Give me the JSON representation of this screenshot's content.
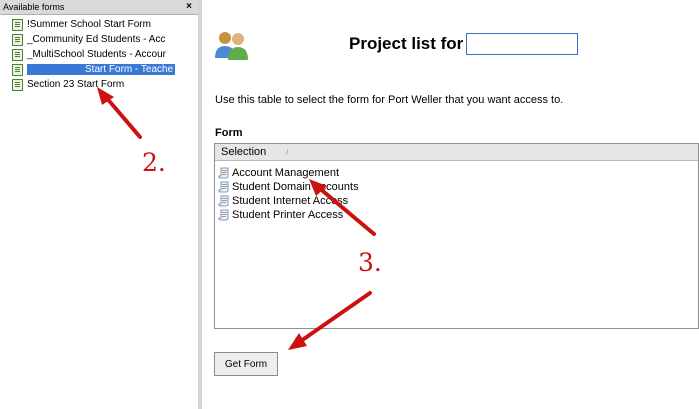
{
  "left_panel": {
    "title": "Available forms",
    "close_glyph": "×",
    "items": [
      {
        "label": "!Summer School Start Form",
        "selected": false
      },
      {
        "label": "_Community Ed Students - Acc",
        "selected": false
      },
      {
        "label": "_MultiSchool Students - Accour",
        "selected": false
      },
      {
        "label": "Start Form - Teache",
        "selected": true
      },
      {
        "label": "Section 23 Start Form",
        "selected": false
      }
    ]
  },
  "main": {
    "title": "Project list for",
    "title_input_value": "",
    "instructions": "Use this table to select the form for Port Weller that you want access to.",
    "form_label": "Form",
    "table": {
      "column_header": "Selection",
      "sort_indicator": "/",
      "rows": [
        "Account Management",
        "Student Domain Accounts",
        "Student Internet Access",
        "Student Printer Access"
      ]
    },
    "get_form_label": "Get Form"
  },
  "annotations": {
    "step2": "2.",
    "step3": "3."
  },
  "colors": {
    "selection": "#3a78d6",
    "annotation_red": "#cc1111",
    "input_border": "#3d6fbf"
  }
}
